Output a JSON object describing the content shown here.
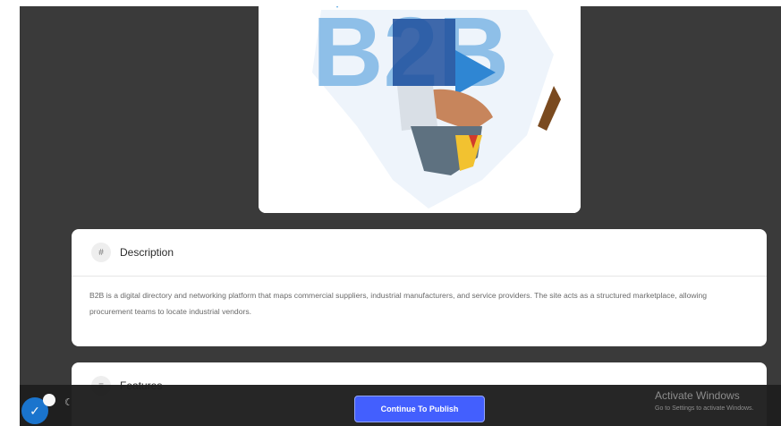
{
  "hero": {
    "image_text": "B2B"
  },
  "description": {
    "icon": "hash-icon",
    "title": "Description",
    "body": "B2B is a digital directory and networking platform that maps commercial suppliers, industrial manufacturers, and service providers. The site acts as a structured marketplace, allowing procurement teams to locate industrial vendors."
  },
  "features": {
    "icon": "list-icon",
    "title": "Features"
  },
  "footer": {
    "publish_label": "Continue To Publish",
    "activate_title": "Activate Windows",
    "activate_sub": "Go to Settings to activate Windows."
  },
  "colors": {
    "accent": "#3d5afe",
    "backdrop": "#3a3a3a",
    "bar": "#1f1f1f"
  }
}
